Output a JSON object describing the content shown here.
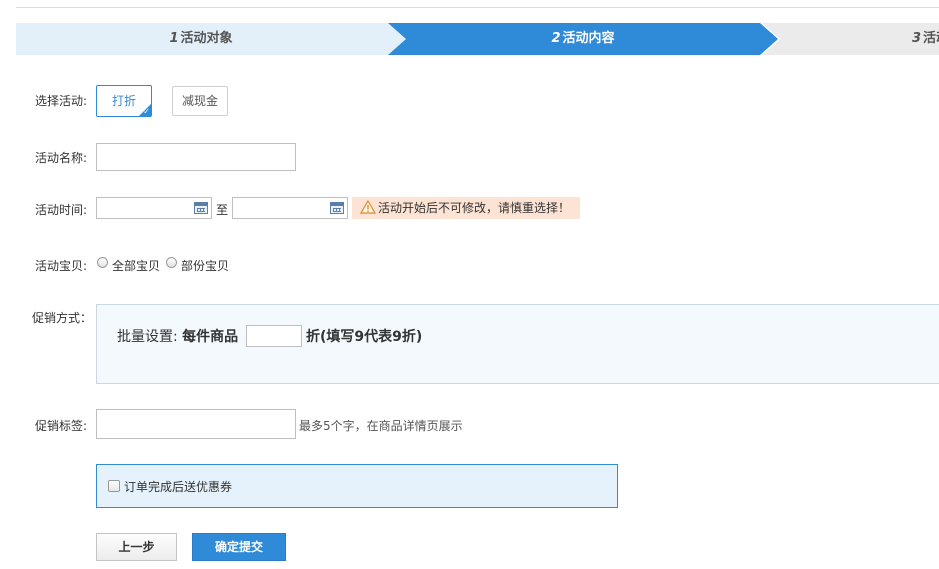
{
  "steps": [
    {
      "num": "1",
      "label": "活动对象",
      "state": "done"
    },
    {
      "num": "2",
      "label": "活动内容",
      "state": "active"
    },
    {
      "num": "3",
      "label": "活动",
      "state": "pending"
    }
  ],
  "colors": {
    "accent": "#2f8ad8",
    "warning_bg": "#fde3d3",
    "step_done_bg": "#e3f0fa",
    "step_pending_bg": "#ebebeb"
  },
  "form": {
    "select_activity": {
      "label": "选择活动:",
      "options": [
        {
          "label": "打折",
          "selected": true
        },
        {
          "label": "减现金",
          "selected": false
        }
      ]
    },
    "activity_name": {
      "label": "活动名称:",
      "value": ""
    },
    "activity_time": {
      "label": "活动时间:",
      "start": "",
      "end": "",
      "separator": "至",
      "warning": "活动开始后不可修改，请慎重选择！"
    },
    "activity_items": {
      "label": "活动宝贝:",
      "options": [
        "全部宝贝",
        "部份宝贝"
      ]
    },
    "promo_method": {
      "label": "促销方式：",
      "prefix": "批量设置:",
      "per_item": "每件商品",
      "value": "",
      "suffix": "折(填写9代表9折)"
    },
    "promo_tag": {
      "label": "促销标签:",
      "value": "",
      "hint": "最多5个字，在商品详情页展示"
    },
    "coupon": {
      "label": "订单完成后送优惠券",
      "checked": false
    }
  },
  "buttons": {
    "prev": "上一步",
    "submit": "确定提交"
  }
}
